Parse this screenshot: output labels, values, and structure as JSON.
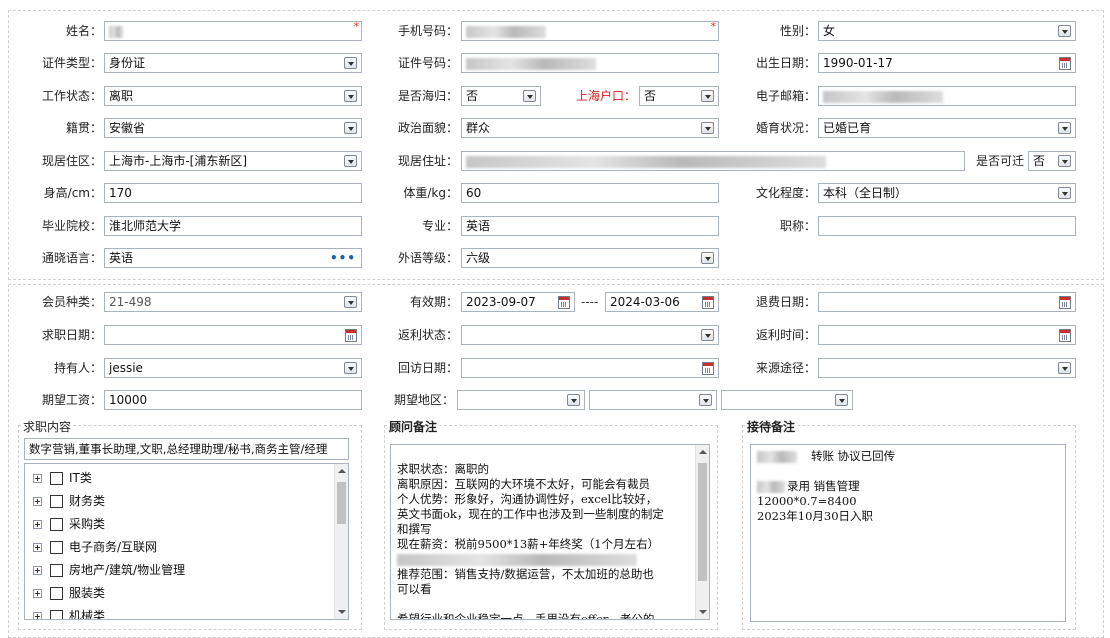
{
  "basic": {
    "name_label": "姓名：",
    "name_value": "",
    "phone_label": "手机号码：",
    "phone_value": "",
    "gender_label": "性别：",
    "gender_value": "女",
    "idtype_label": "证件类型：",
    "idtype_value": "身份证",
    "idno_label": "证件号码：",
    "idno_value": "",
    "birth_label": "出生日期：",
    "birth_value": "1990-01-17",
    "work_label": "工作状态：",
    "work_value": "离职",
    "returnee_label": "是否海归：",
    "returnee_value": "否",
    "shanghai_label": "上海户口：",
    "shanghai_value": "否",
    "email_label": "电子邮箱：",
    "email_value": "",
    "native_label": "籍贯：",
    "native_value": "安徽省",
    "political_label": "政治面貌：",
    "political_value": "群众",
    "marital_label": "婚育状况：",
    "marital_value": "已婚已育",
    "residence_label": "现居住区：",
    "residence_value": "上海市-上海市-[浦东新区]",
    "address_label": "现居住址：",
    "address_value": "",
    "relocate_label": "是否可迁",
    "relocate_value": "否",
    "height_label": "身高/cm：",
    "height_value": "170",
    "weight_label": "体重/kg：",
    "weight_value": "60",
    "edu_label": "文化程度：",
    "edu_value": "本科（全日制）",
    "school_label": "毕业院校：",
    "school_value": "淮北师范大学",
    "major_label": "专业：",
    "major_value": "英语",
    "title_label": "职称：",
    "title_value": "",
    "lang_label": "通晓语言：",
    "lang_value": "英语",
    "langlevel_label": "外语等级：",
    "langlevel_value": "六级"
  },
  "member": {
    "type_label": "会员种类：",
    "type_value": "21-498",
    "valid_label": "有效期：",
    "valid_from": "2023-09-07",
    "valid_sep": "----",
    "valid_to": "2024-03-06",
    "refund_label": "退费日期：",
    "refund_value": "",
    "jobdate_label": "求职日期：",
    "jobdate_value": "",
    "rebate_label": "返利状态：",
    "rebate_value": "",
    "rebatetime_label": "返利时间：",
    "rebatetime_value": "",
    "holder_label": "持有人：",
    "holder_value": "jessie",
    "visit_label": "回访日期：",
    "visit_value": "",
    "source_label": "来源途径：",
    "source_value": "",
    "salary_label": "期望工资：",
    "salary_value": "10000",
    "area_label": "期望地区：",
    "area_value1": "",
    "area_value2": "",
    "area_value3": ""
  },
  "job_content": {
    "title": "求职内容",
    "summary": "数字营销,董事长助理,文职,总经理助理/秘书,商务主管/经理",
    "categories": [
      "IT类",
      "财务类",
      "采购类",
      "电子商务/互联网",
      "房地产/建筑/物业管理",
      "服装类",
      "机械类"
    ]
  },
  "consultant": {
    "title": "顾问备注",
    "lines": [
      "求职状态：离职的",
      "离职原因：互联网的大环境不太好，可能会有裁员",
      "个人优势：形象好，沟通协调性好，excel比较好，",
      "英文书面ok，现在的工作中也涉及到一些制度的制定",
      "和撰写",
      "现在薪资：税前9500*13薪+年终奖（1个月左右）",
      "",
      "推荐范围：销售支持/数据运营，不太加班的总助也",
      "可以看",
      "",
      "希望行业和企业稳定一点，手里没有offer，老公的"
    ]
  },
  "reception": {
    "title": "接待备注",
    "line1": "转账  协议已回传",
    "line2": "录用 销售管理",
    "line3": "12000*0.7=8400",
    "line4": "2023年10月30日入职"
  }
}
